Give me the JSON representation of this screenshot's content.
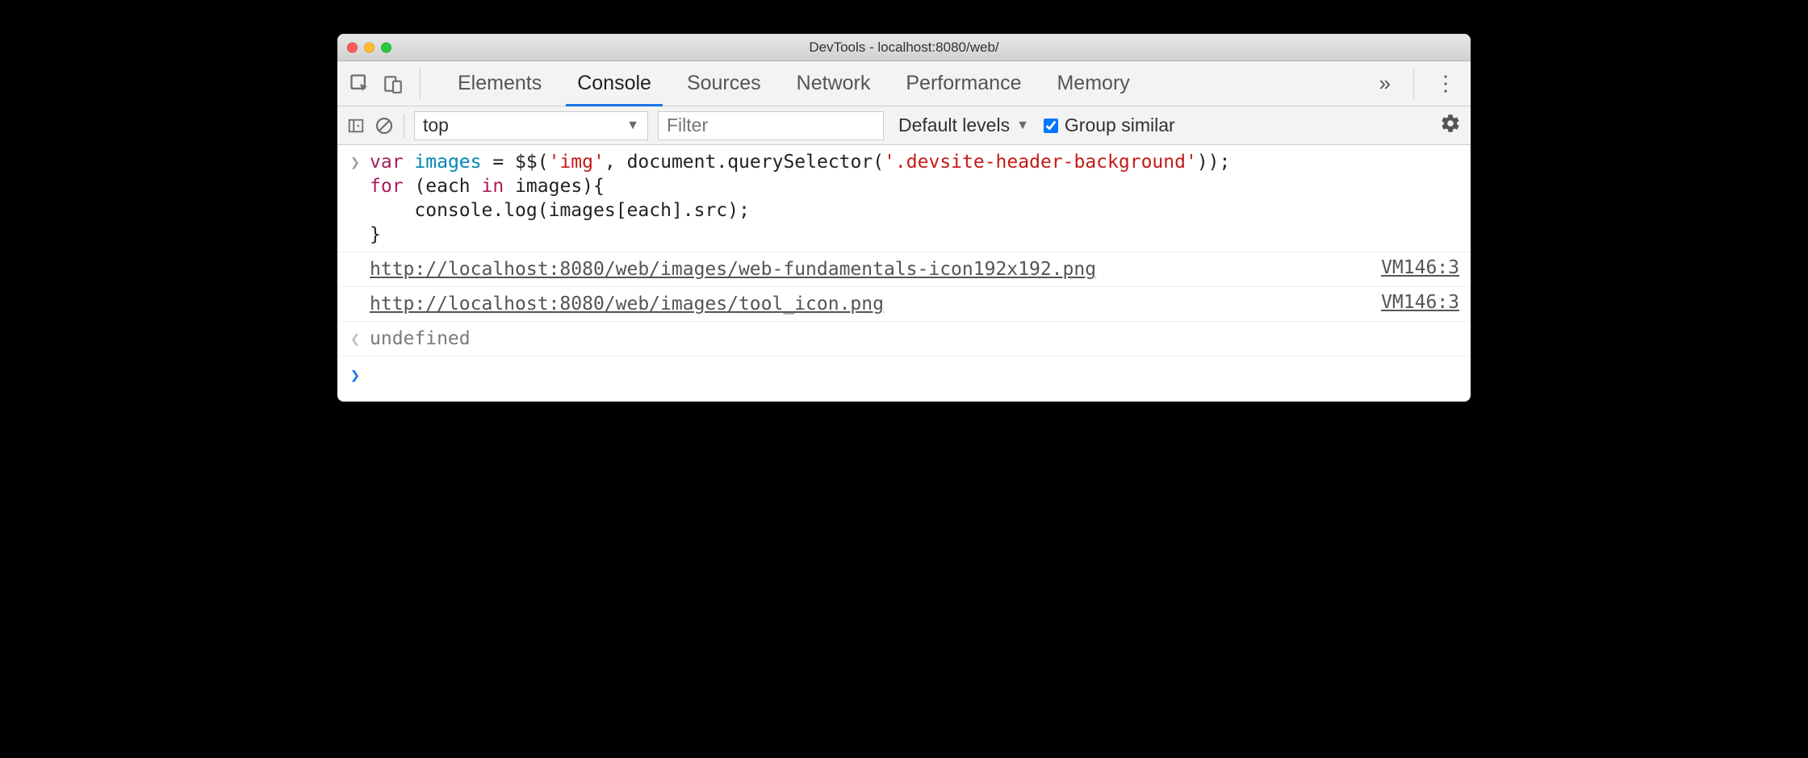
{
  "window": {
    "title": "DevTools - localhost:8080/web/"
  },
  "tabs": {
    "elements": "Elements",
    "console": "Console",
    "sources": "Sources",
    "network": "Network",
    "performance": "Performance",
    "memory": "Memory",
    "overflow_glyph": "»"
  },
  "console_toolbar": {
    "context": "top",
    "filter_placeholder": "Filter",
    "levels": "Default levels",
    "group_similar": "Group similar",
    "group_similar_checked": true
  },
  "code": {
    "tokens": {
      "var": "var",
      "images": "images",
      "eq": " = ",
      "dollars": "$$",
      "lp": "(",
      "str_img": "'img'",
      "comma": ", ",
      "doc": "document",
      "dot": ".",
      "qs": "querySelector",
      "str_sel": "'.devsite-header-background'",
      "rp": ")",
      "rp2": ")",
      "semi": ";",
      "for": "for",
      "sp": " ",
      "each": "each",
      "in": "in",
      "images2": "images",
      "brace_o": "{",
      "indent": "    ",
      "console": "console",
      "log": "log",
      "images3": "images",
      "lbr": "[",
      "each2": "each",
      "rbr": "]",
      "src": "src",
      "brace_c": "}"
    }
  },
  "logs": [
    {
      "text": "http://localhost:8080/web/images/web-fundamentals-icon192x192.png",
      "source": "VM146:3"
    },
    {
      "text": "http://localhost:8080/web/images/tool_icon.png",
      "source": "VM146:3"
    }
  ],
  "return_value": "undefined"
}
